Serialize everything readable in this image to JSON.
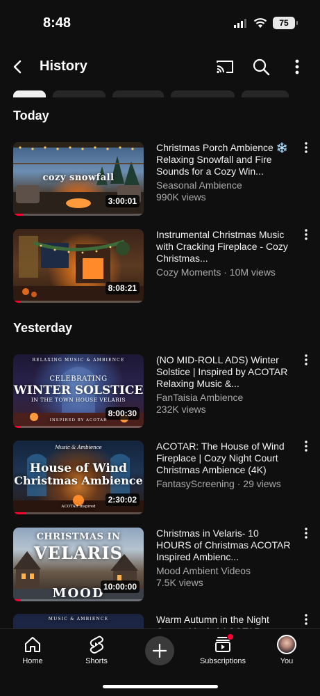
{
  "status": {
    "time": "8:48",
    "battery": "75"
  },
  "header": {
    "title": "History"
  },
  "sections": [
    {
      "title": "Today"
    },
    {
      "title": "Yesterday"
    }
  ],
  "videos": [
    {
      "title": "Christmas Porch Ambience ❄️ Relaxing Snowfall and Fire Sounds for a Cozy Win...",
      "meta_line1": "Seasonal Ambience",
      "meta_line2": "990K views",
      "duration": "3:00:01",
      "overlay": "cozy snowfall",
      "progress": 0.08
    },
    {
      "title": "Instrumental Christmas Music with Cracking Fireplace - Cozy Christmas...",
      "meta_line1": "Cozy Moments · 10M views",
      "meta_line2": "",
      "duration": "8:08:21",
      "overlay": "",
      "progress": 0.06
    },
    {
      "title": "(NO MID-ROLL ADS) Winter Solstice | Inspired by ACOTAR Relaxing Music &...",
      "meta_line1": "FanTaisia Ambience",
      "meta_line2": "232K views",
      "duration": "8:00:30",
      "overlay_top": "RELAXING MUSIC & AMBIENCE",
      "overlay": "CELEBRATING",
      "overlay2": "WINTER SOLSTICE",
      "overlay3": "IN THE TOWN HOUSE VELARIS",
      "overlay4": "INSPIRED BY ACOTAR",
      "progress": 0.06
    },
    {
      "title": "ACOTAR: The House of Wind Fireplace | Cozy Night Court Christmas Ambience (4K)",
      "meta_line1": "FantasyScreening · 29 views",
      "meta_line2": "",
      "duration": "2:30:02",
      "overlay_top": "Music & Ambience",
      "overlay": "House of Wind",
      "overlay2": "Christmas Ambience",
      "overlay3": "ACOTAR Inspired",
      "progress": 0.1
    },
    {
      "title": "Christmas in Velaris- 10 HOURS of Christmas ACOTAR Inspired Ambienc...",
      "meta_line1": "Mood Ambient Videos",
      "meta_line2": "7.5K views",
      "duration": "10:00:00",
      "overlay": "CHRISTMAS IN",
      "overlay2": "VELARIS",
      "overlay3": "MOOD",
      "progress": 0.06
    },
    {
      "title": "Warm Autumn in the Night Court - Music | ACOTAR...",
      "meta_line1": "",
      "meta_line2": "",
      "duration": "",
      "overlay_top": "MUSIC & AMBIENCE",
      "progress": 0
    }
  ],
  "nav": [
    {
      "label": "Home",
      "icon": "home-icon"
    },
    {
      "label": "Shorts",
      "icon": "shorts-icon"
    },
    {
      "label": "",
      "icon": "plus-icon"
    },
    {
      "label": "Subscriptions",
      "icon": "subscriptions-icon"
    },
    {
      "label": "You",
      "icon": "avatar"
    }
  ],
  "colors": {
    "background": "#0f0f0f",
    "accent": "#ff0033",
    "secondary_text": "#aaaaaa"
  }
}
